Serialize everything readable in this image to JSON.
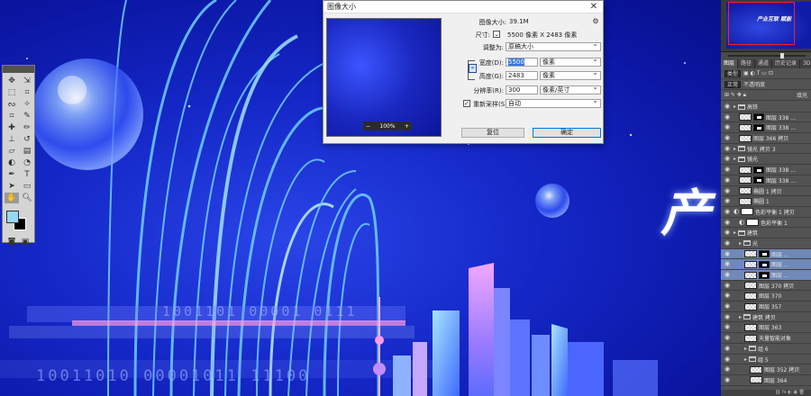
{
  "canvas": {
    "binary_row1": "1001101  00001 0111",
    "binary_row2": "10011010  00001011 11100",
    "title_char": "产"
  },
  "toolbar": {
    "tools": [
      "move-icon",
      "move-alt-icon",
      "marquee-icon",
      "marquee-alt-icon",
      "lasso-icon",
      "lasso-alt-icon",
      "quick-select-icon",
      "crop-icon",
      "eyedropper-icon",
      "healing-icon",
      "brush-icon",
      "stamp-icon",
      "history-brush-icon",
      "eraser-icon",
      "gradient-icon",
      "blur-icon",
      "dodge-icon",
      "pen-icon",
      "type-icon",
      "path-select-icon",
      "shape-icon",
      "hand-icon",
      "zoom-icon"
    ],
    "colors": {
      "foreground": "#97d6f5",
      "background": "#000000"
    }
  },
  "dialog": {
    "title": "图像大小",
    "close": "✕",
    "image_size_label": "图像大小:",
    "image_size_value": "39.1M",
    "dimensions_label": "尺寸:",
    "dimensions_value": "5500 像素  X  2483 像素",
    "fit_label": "调整为:",
    "fit_value": "原稿大小",
    "width_label": "宽度(D):",
    "width_value": "5500",
    "width_unit": "像素",
    "height_label": "高度(G):",
    "height_value": "2483",
    "height_unit": "像素",
    "resolution_label": "分辨率(R):",
    "resolution_value": "300",
    "resolution_unit": "像素/英寸",
    "resample_label": "重新采样(S):",
    "resample_value": "自动",
    "preview_zoom": "100%",
    "zoom_minus": "−",
    "zoom_plus": "+",
    "reset_button": "复位",
    "ok_button": "确定"
  },
  "right_panel": {
    "navigator_thumb_text": "产业互联 赋能",
    "tabs": [
      "图层",
      "路径",
      "通道",
      "历史记录",
      "3D"
    ],
    "filter_label": "类型",
    "blend_mode": "正常",
    "opacity_label": "不透明度",
    "fill_label": "填充",
    "layers": [
      {
        "name": "高铁",
        "type": "group",
        "indent": 0
      },
      {
        "name": "图层 338 ...",
        "type": "masked",
        "indent": 1
      },
      {
        "name": "图层 338 ...",
        "type": "masked",
        "indent": 1
      },
      {
        "name": "图层 366 拷贝",
        "type": "layer",
        "indent": 1
      },
      {
        "name": "镜光 拷贝 3",
        "type": "group",
        "indent": 0
      },
      {
        "name": "镜光",
        "type": "group",
        "indent": 0
      },
      {
        "name": "图层 338 ...",
        "type": "masked",
        "indent": 1
      },
      {
        "name": "图层 338 ...",
        "type": "masked",
        "indent": 1
      },
      {
        "name": "椭圆 1 拷贝",
        "type": "layer",
        "indent": 1
      },
      {
        "name": "椭圆 1",
        "type": "layer",
        "indent": 1
      },
      {
        "name": "色彩平衡 1 拷贝",
        "type": "adjust",
        "indent": 0
      },
      {
        "name": "色彩平衡 1",
        "type": "adjust",
        "indent": 1
      },
      {
        "name": "建筑",
        "type": "group",
        "indent": 0
      },
      {
        "name": "光",
        "type": "group",
        "indent": 1
      },
      {
        "name": "图层 ...",
        "type": "masked",
        "indent": 2,
        "selected": true
      },
      {
        "name": "图层 ...",
        "type": "masked",
        "indent": 2,
        "selected": true
      },
      {
        "name": "图层 ...",
        "type": "masked",
        "indent": 2,
        "selected": true
      },
      {
        "name": "图层 370 拷贝",
        "type": "layer",
        "indent": 2
      },
      {
        "name": "图层 370",
        "type": "layer",
        "indent": 2
      },
      {
        "name": "图层 357",
        "type": "layer",
        "indent": 2
      },
      {
        "name": "建筑 拷贝",
        "type": "group",
        "indent": 1
      },
      {
        "name": "图层 363",
        "type": "layer",
        "indent": 2
      },
      {
        "name": "天量智能对象",
        "type": "smart",
        "indent": 2
      },
      {
        "name": "组 6",
        "type": "group",
        "indent": 2
      },
      {
        "name": "组 5",
        "type": "group",
        "indent": 2
      },
      {
        "name": "图层 352 拷贝",
        "type": "layer",
        "indent": 3
      },
      {
        "name": "图层 364",
        "type": "layer",
        "indent": 3
      }
    ]
  }
}
